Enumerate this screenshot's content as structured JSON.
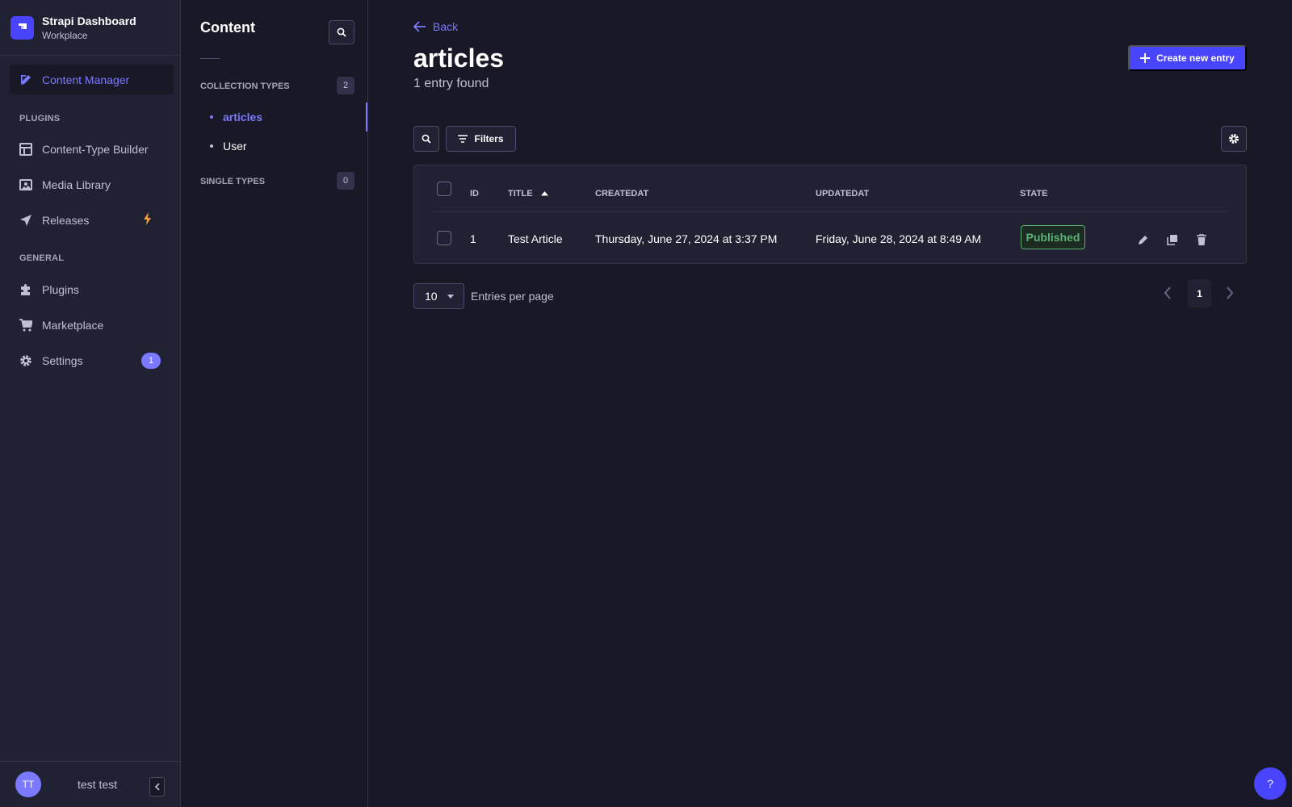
{
  "brand": {
    "title": "Strapi Dashboard",
    "subtitle": "Workplace"
  },
  "mainnav": {
    "content_manager": "Content Manager",
    "plugins_section": "PLUGINS",
    "content_type_builder": "Content-Type Builder",
    "media_library": "Media Library",
    "releases": "Releases",
    "general_section": "GENERAL",
    "plugins": "Plugins",
    "marketplace": "Marketplace",
    "settings": "Settings",
    "settings_badge": "1"
  },
  "user": {
    "initials": "TT",
    "name": "test test"
  },
  "subnav": {
    "title": "Content",
    "collection_types": "COLLECTION TYPES",
    "collection_count": "2",
    "items": [
      {
        "label": "articles"
      },
      {
        "label": "User"
      }
    ],
    "single_types": "SINGLE TYPES",
    "single_count": "0"
  },
  "header": {
    "back": "Back",
    "title": "articles",
    "subtitle": "1 entry found",
    "create_label": "Create new entry"
  },
  "toolbar": {
    "filters_label": "Filters"
  },
  "table": {
    "columns": [
      "ID",
      "TITLE",
      "CREATEDAT",
      "UPDATEDAT",
      "STATE"
    ],
    "rows": [
      {
        "id": "1",
        "title": "Test Article",
        "createdAt": "Thursday, June 27, 2024 at 3:37 PM",
        "updatedAt": "Friday, June 28, 2024 at 8:49 AM",
        "state": "Published"
      }
    ]
  },
  "pagination": {
    "per_page_value": "10",
    "per_page_label": "Entries per page",
    "current_page": "1"
  },
  "help": {
    "label": "?"
  },
  "colors": {
    "accent": "#7b79ff",
    "primary": "#4945ff",
    "success": "#5cb176",
    "warning": "#f29d41"
  }
}
